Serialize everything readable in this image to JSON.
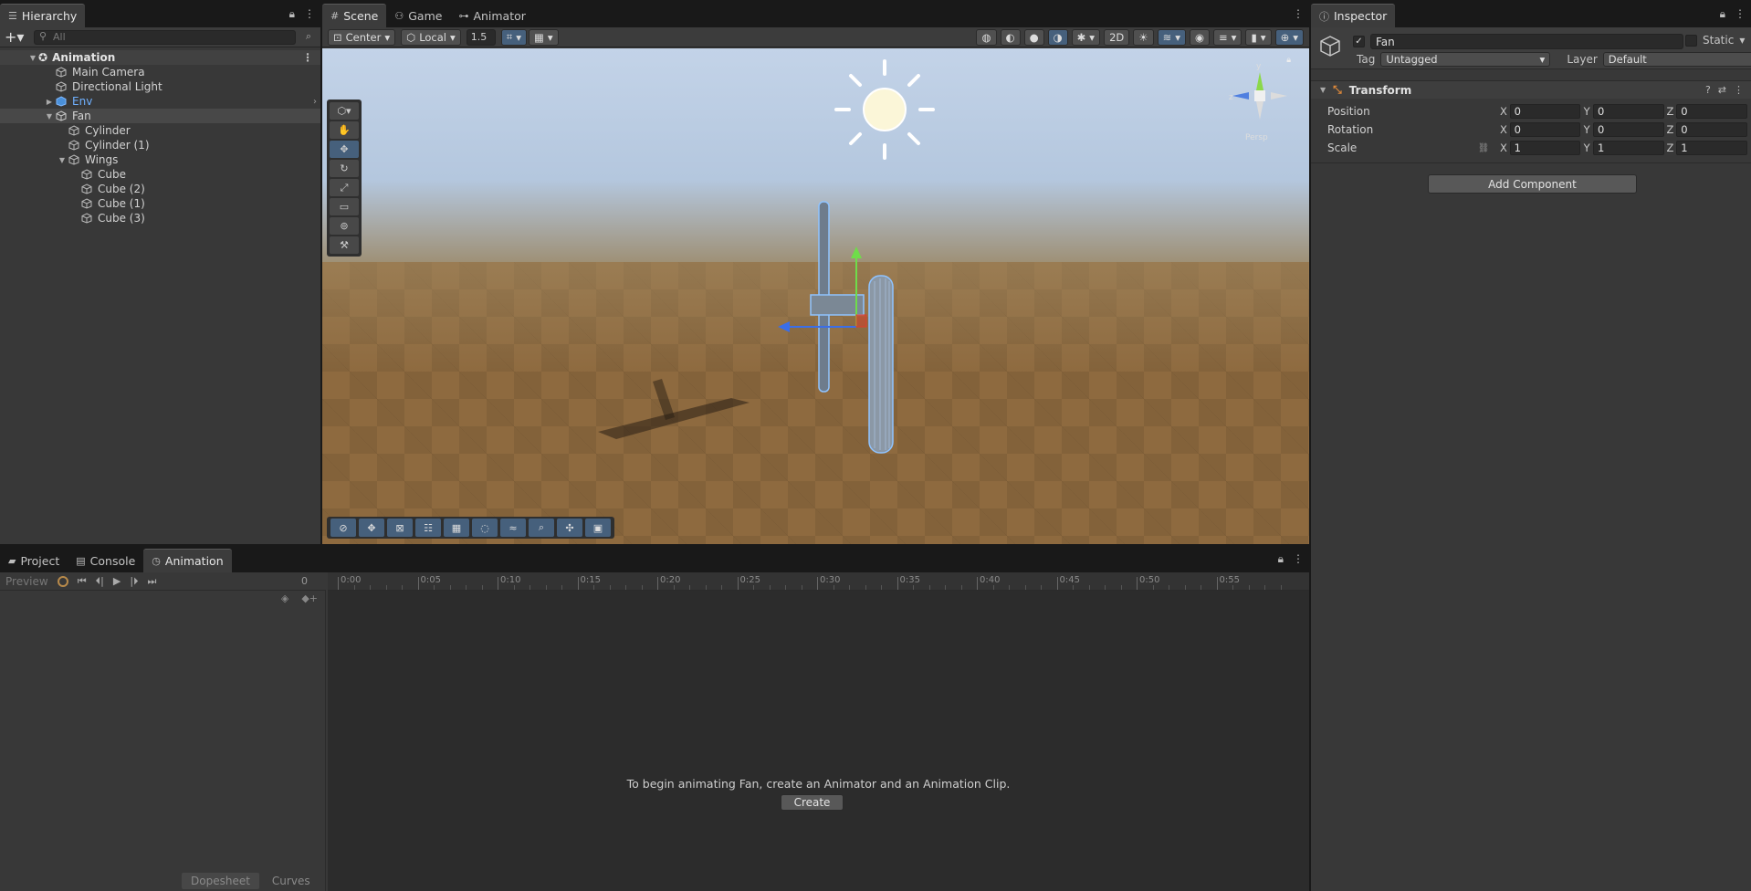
{
  "hierarchy": {
    "tab": "Hierarchy",
    "search_placeholder": "All",
    "scene": "Animation",
    "items": [
      {
        "label": "Main Camera"
      },
      {
        "label": "Directional Light"
      },
      {
        "label": "Env"
      },
      {
        "label": "Fan"
      },
      {
        "label": "Cylinder"
      },
      {
        "label": "Cylinder (1)"
      },
      {
        "label": "Wings"
      },
      {
        "label": "Cube"
      },
      {
        "label": "Cube (2)"
      },
      {
        "label": "Cube (1)"
      },
      {
        "label": "Cube (3)"
      }
    ]
  },
  "scene": {
    "tabs": [
      {
        "label": "Scene"
      },
      {
        "label": "Game"
      },
      {
        "label": "Animator"
      }
    ],
    "pivot": "Center",
    "space": "Local",
    "snap": "1.5",
    "gizmo_label": "Persp"
  },
  "inspector": {
    "tab": "Inspector",
    "name": "Fan",
    "static": "Static",
    "tag_label": "Tag",
    "tag": "Untagged",
    "layer_label": "Layer",
    "layer": "Default",
    "component": "Transform",
    "rows": [
      {
        "label": "Position",
        "x": "0",
        "y": "0",
        "z": "0"
      },
      {
        "label": "Rotation",
        "x": "0",
        "y": "0",
        "z": "0"
      },
      {
        "label": "Scale",
        "x": "1",
        "y": "1",
        "z": "1"
      }
    ],
    "axis": {
      "x": "X",
      "y": "Y",
      "z": "Z"
    },
    "add_component": "Add Component"
  },
  "animation": {
    "tabs": [
      {
        "label": "Project"
      },
      {
        "label": "Console"
      },
      {
        "label": "Animation"
      }
    ],
    "preview": "Preview",
    "frame": "0",
    "ticks": [
      "0:00",
      "0:05",
      "0:10",
      "0:15",
      "0:20",
      "0:25",
      "0:30",
      "0:35",
      "0:40",
      "0:45",
      "0:50",
      "0:55"
    ],
    "message": "To begin animating Fan, create an Animator and an Animation Clip.",
    "create": "Create",
    "dopesheet": "Dopesheet",
    "curves": "Curves"
  },
  "colors": {
    "accent_blue": "#46607c",
    "link_blue": "#6fb0ff"
  }
}
